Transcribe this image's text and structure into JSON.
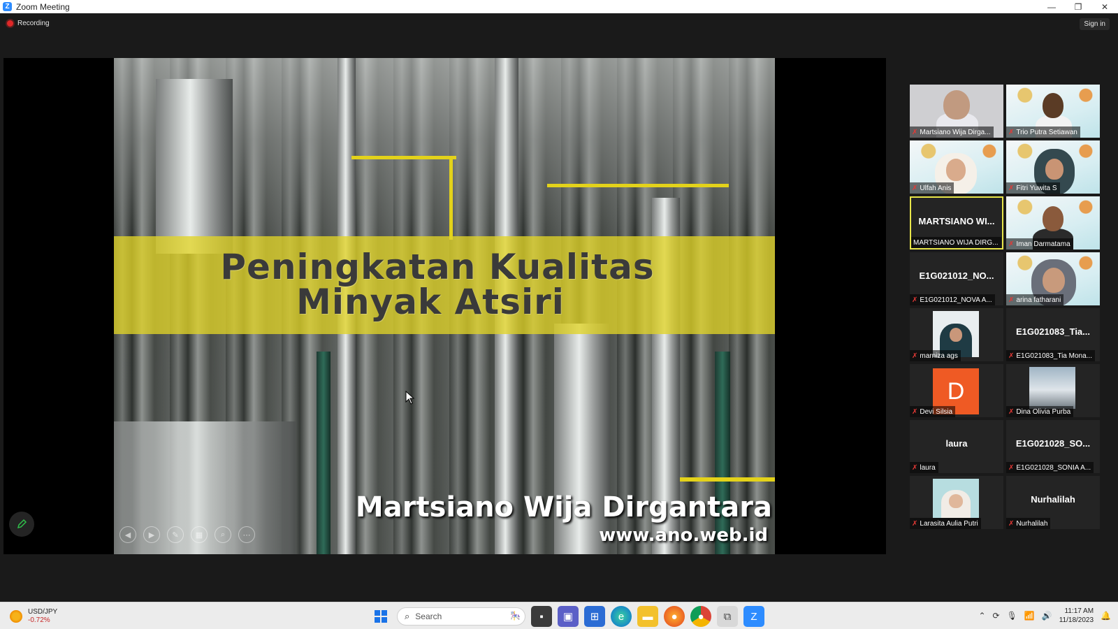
{
  "window": {
    "title": "Zoom Meeting",
    "minimize": "—",
    "restore": "❐",
    "close": "✕"
  },
  "toolbar": {
    "recording": "Recording",
    "signin": "Sign in"
  },
  "slide": {
    "title_line1": "Peningkatan Kualitas",
    "title_line2": "Minyak Atsiri",
    "author": "Martsiano Wija Dirgantara",
    "website": "www.ano.web.id"
  },
  "participants": [
    {
      "label": "Martsiano Wija Dirga...",
      "video": "photo"
    },
    {
      "label": "Trio Putra Setiawan",
      "video": "poster"
    },
    {
      "label": "Ulfah Anis",
      "video": "poster"
    },
    {
      "label": "Fitri Yuwita S",
      "video": "poster"
    },
    {
      "label": "MARTSIANO WIJA DIRG...",
      "display_name": "MARTSIANO WI...",
      "video": "name",
      "active_speaker": true
    },
    {
      "label": "Iman Darmatama",
      "video": "poster"
    },
    {
      "label": "E1G021012_NOVA A...",
      "display_name": "E1G021012_NO...",
      "video": "name"
    },
    {
      "label": "arina fatharani",
      "video": "poster"
    },
    {
      "label": "marniza ags",
      "video": "photo"
    },
    {
      "label": "E1G021083_Tia Mona...",
      "display_name": "E1G021083_Tia...",
      "video": "name"
    },
    {
      "label": "Devi Silsia",
      "avatar_letter": "D",
      "video": "avatar"
    },
    {
      "label": "Dina Olivia Purba",
      "video": "photo"
    },
    {
      "label": "laura",
      "display_name": "laura",
      "video": "name"
    },
    {
      "label": "E1G021028_SONIA A...",
      "display_name": "E1G021028_SO...",
      "video": "name"
    },
    {
      "label": "Larasita Aulia Putri",
      "video": "photo"
    },
    {
      "label": "Nurhalilah",
      "display_name": "Nurhalilah",
      "video": "name"
    }
  ],
  "taskbar": {
    "ticker_symbol": "USD/JPY",
    "ticker_change": "-0.72%",
    "search_placeholder": "Search",
    "time": "11:17 AM",
    "date": "11/18/2023"
  },
  "colors": {
    "zoom_blue": "#2d8cff",
    "active_speaker": "#e8e64a",
    "recording": "#e02828",
    "muted": "#e53935",
    "avatar_d": "#ef5a24"
  }
}
